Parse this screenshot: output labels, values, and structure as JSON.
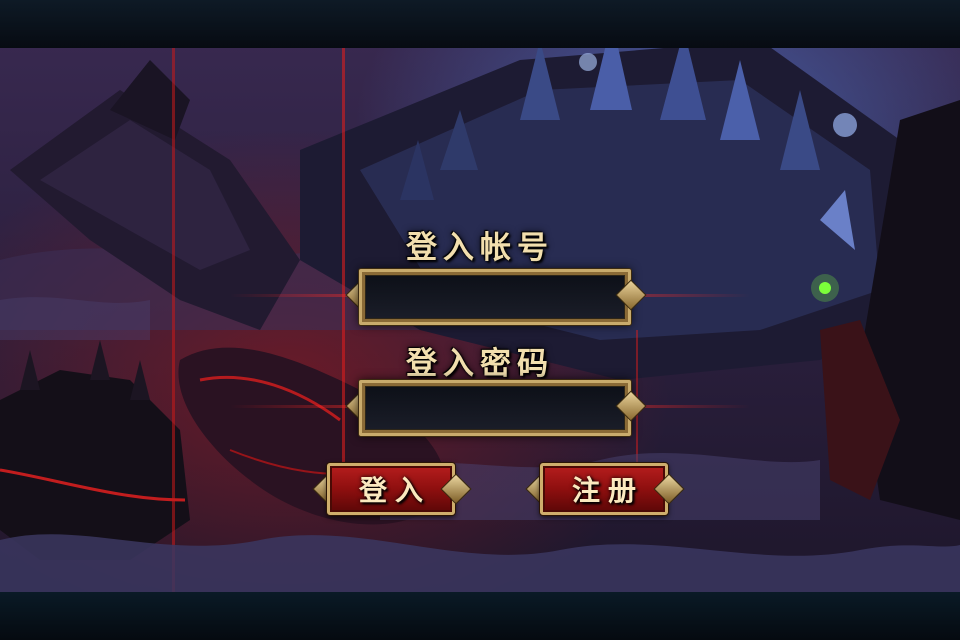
{
  "login_form": {
    "account_label": "登入帐号",
    "account_value": "",
    "password_label": "登入密码",
    "password_value": ""
  },
  "buttons": {
    "login_label": "登入",
    "register_label": "注册"
  },
  "colors": {
    "label_gold": "#f2dfae",
    "frame_gold": "#c9ab6c",
    "button_red": "#8e0f0f",
    "sky_purple": "#2c1f40",
    "lava_red": "#d81e1e"
  },
  "icons": [
    "diamond-ornament-icon"
  ]
}
